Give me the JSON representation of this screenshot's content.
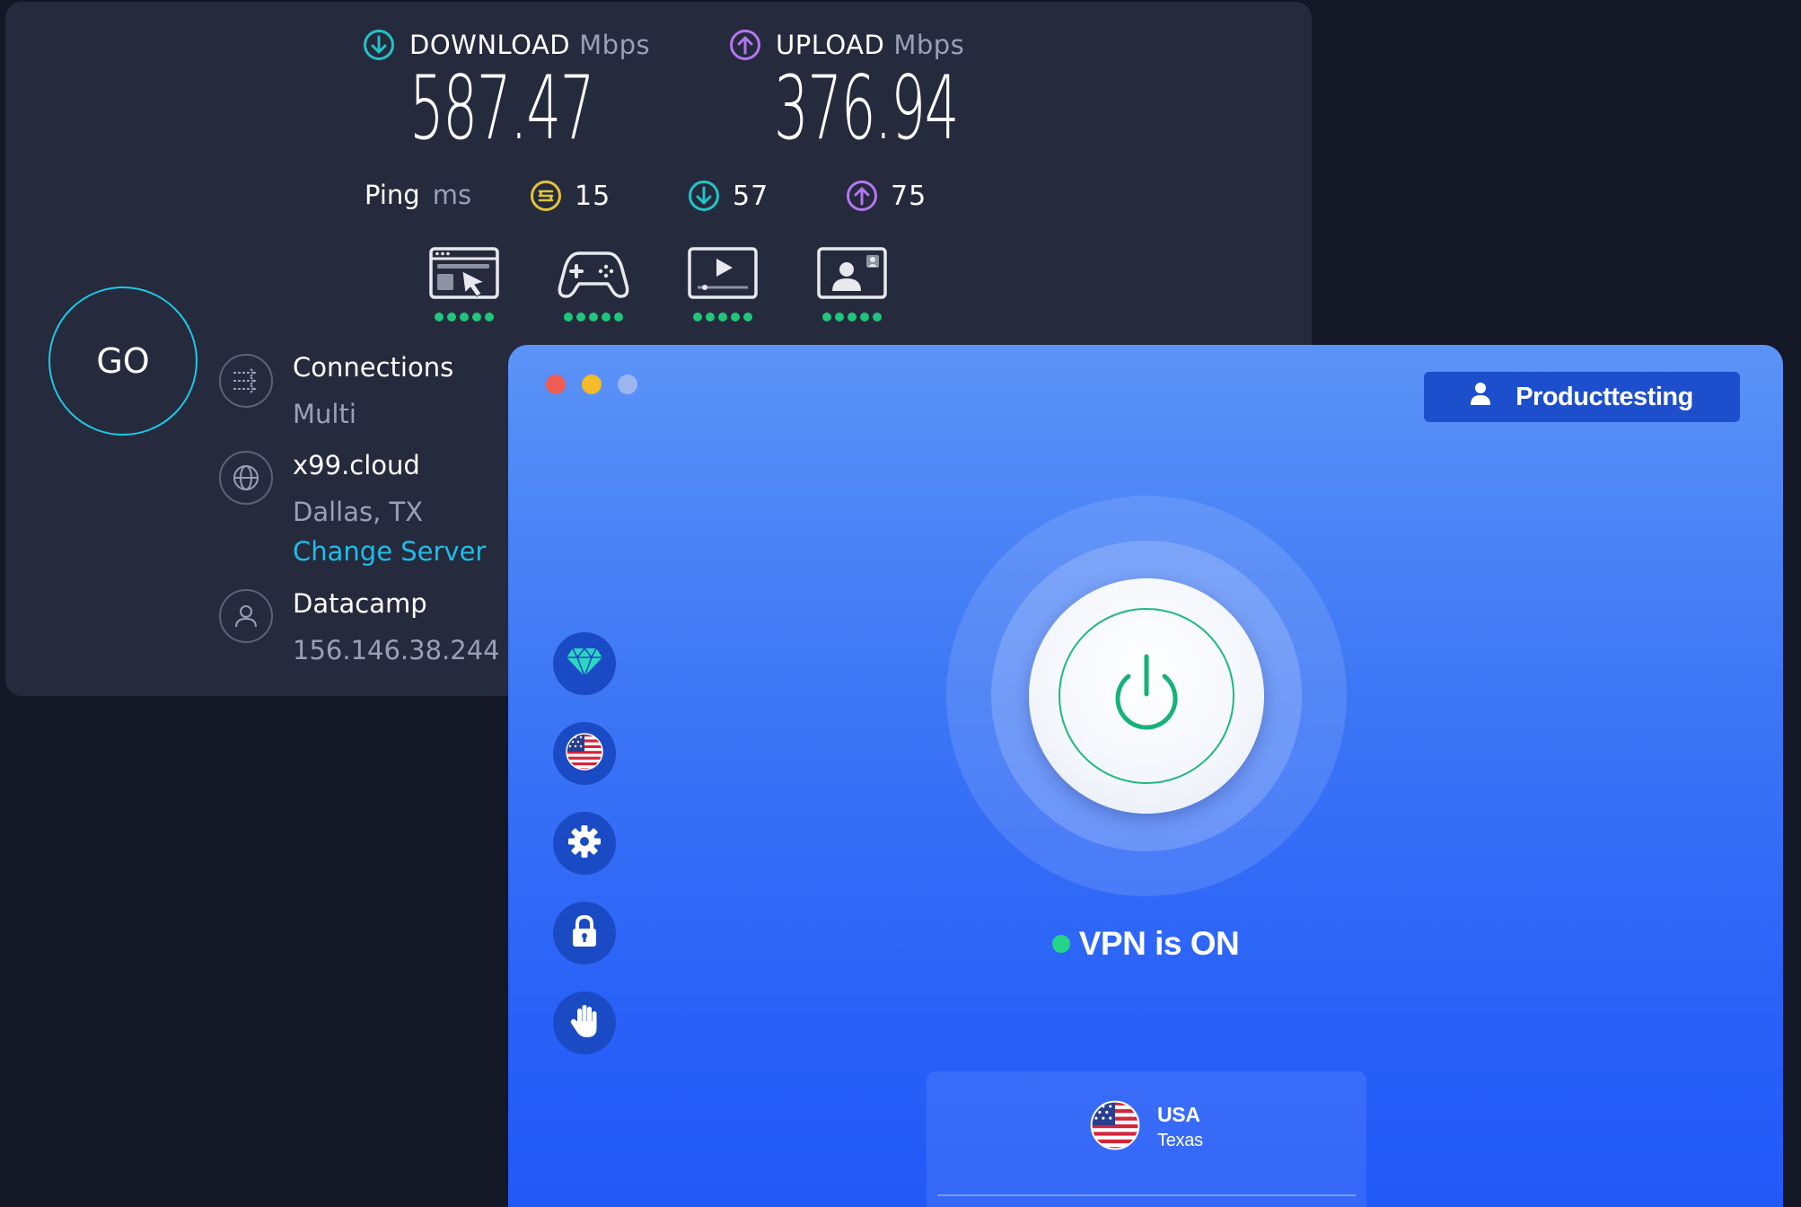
{
  "speedtest": {
    "download": {
      "label": "DOWNLOAD",
      "unit": "Mbps",
      "value": "587.47",
      "icon": "arrow-down-circle-icon",
      "color": "#22c3c7"
    },
    "upload": {
      "label": "UPLOAD",
      "unit": "Mbps",
      "value": "376.94",
      "icon": "arrow-up-circle-icon",
      "color": "#b377ef"
    },
    "ping": {
      "label": "Ping",
      "unit": "ms",
      "idle": {
        "value": "15",
        "icon": "jitter-icon",
        "color": "#e0c33a"
      },
      "down": {
        "value": "57",
        "icon": "arrow-down-circle-icon",
        "color": "#22c3c7"
      },
      "up": {
        "value": "75",
        "icon": "arrow-up-circle-icon",
        "color": "#b377ef"
      }
    },
    "activities": [
      {
        "name": "web-browsing-icon",
        "rating": 5
      },
      {
        "name": "gaming-icon",
        "rating": 5
      },
      {
        "name": "video-streaming-icon",
        "rating": 5
      },
      {
        "name": "video-chat-icon",
        "rating": 5
      }
    ],
    "go_label": "GO",
    "connections": {
      "title": "Connections",
      "value": "Multi"
    },
    "server": {
      "name": "x99.cloud",
      "location": "Dallas, TX",
      "change_label": "Change Server"
    },
    "provider": {
      "name": "Datacamp",
      "ip": "156.146.38.244"
    }
  },
  "vpn": {
    "user_label": "Producttesting",
    "status_text": "VPN is ON",
    "status_color": "#23d489",
    "sidebar": [
      "premium-diamond-icon",
      "usa-flag-icon",
      "settings-gear-icon",
      "lock-icon",
      "hand-block-icon"
    ],
    "location": {
      "country": "USA",
      "region": "Texas",
      "flag": "usa-flag-icon"
    }
  }
}
